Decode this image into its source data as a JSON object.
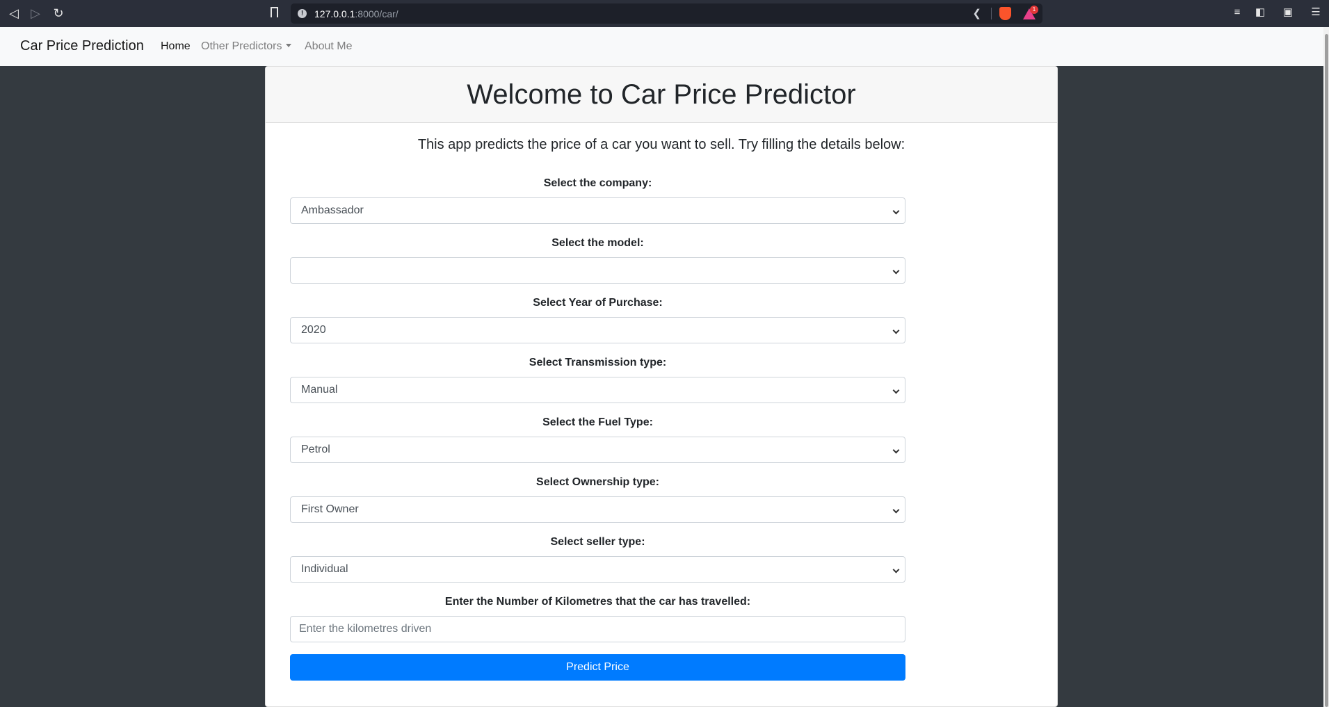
{
  "browser": {
    "url_host": "127.0.0.1",
    "url_rest": ":8000/car/",
    "rewards_badge": "1"
  },
  "navbar": {
    "brand": "Car Price Prediction",
    "links": [
      {
        "label": "Home",
        "active": true
      },
      {
        "label": "Other Predictors",
        "dropdown": true
      },
      {
        "label": "About Me"
      }
    ]
  },
  "card": {
    "title": "Welcome to Car Price Predictor",
    "lead": "This app predicts the price of a car you want to sell. Try filling the details below:"
  },
  "form": {
    "company": {
      "label": "Select the company:",
      "value": "Ambassador"
    },
    "model": {
      "label": "Select the model:",
      "value": ""
    },
    "year": {
      "label": "Select Year of Purchase:",
      "value": "2020"
    },
    "transmission": {
      "label": "Select Transmission type:",
      "value": "Manual"
    },
    "fuel": {
      "label": "Select the Fuel Type:",
      "value": "Petrol"
    },
    "ownership": {
      "label": "Select Ownership type:",
      "value": "First Owner"
    },
    "seller": {
      "label": "Select seller type:",
      "value": "Individual"
    },
    "kms": {
      "label": "Enter the Number of Kilometres that the car has travelled:",
      "placeholder": "Enter the kilometres driven"
    },
    "submit_label": "Predict Price"
  },
  "colors": {
    "primary": "#007bff",
    "page_background": "#343a40",
    "navbar_background": "#f8f9fa"
  }
}
